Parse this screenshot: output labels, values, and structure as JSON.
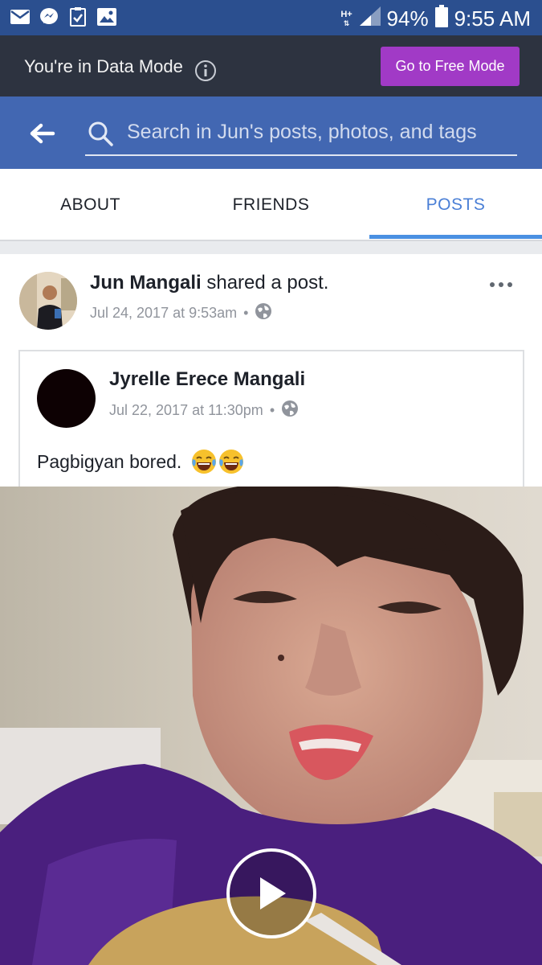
{
  "status_bar": {
    "network": "H+",
    "battery": "94%",
    "time": "9:55 AM",
    "icons": [
      "mail-icon",
      "messenger-icon",
      "checklist-icon",
      "gallery-icon",
      "signal-icon",
      "battery-icon"
    ]
  },
  "data_mode": {
    "message": "You're in Data Mode",
    "button_label": "Go to Free Mode",
    "button_color": "#a13ac6"
  },
  "search": {
    "placeholder": "Search in Jun's posts, photos, and tags"
  },
  "tabs": [
    {
      "label": "ABOUT",
      "active": false
    },
    {
      "label": "FRIENDS",
      "active": false
    },
    {
      "label": "POSTS",
      "active": true
    }
  ],
  "post": {
    "author": "Jun Mangali",
    "action": "shared a post.",
    "timestamp": "Jul 24, 2017 at 9:53am",
    "separator": "•",
    "privacy_icon": "globe-icon",
    "shared": {
      "author": "Jyrelle Erece Mangali",
      "timestamp": "Jul 22, 2017 at 11:30pm",
      "separator": "•",
      "text": "Pagbigyan bored.",
      "emojis": [
        "face-with-tears-of-joy",
        "face-with-tears-of-joy"
      ]
    },
    "media": {
      "type": "video",
      "play_icon": "play-icon"
    }
  },
  "colors": {
    "status_bar": "#2b4f8f",
    "data_bar": "#2d3340",
    "header": "#4267b2",
    "active_tab": "#4a90e2"
  }
}
